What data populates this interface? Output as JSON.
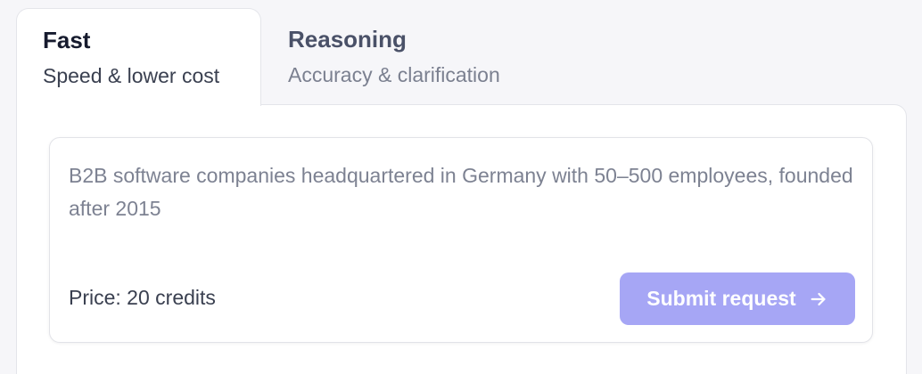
{
  "tabs": [
    {
      "title": "Fast",
      "subtitle": "Speed & lower cost",
      "active": true
    },
    {
      "title": "Reasoning",
      "subtitle": "Accuracy & clarification",
      "active": false
    }
  ],
  "query": {
    "text": "B2B software companies headquartered in Germany with 50–500 employees, founded after 2015"
  },
  "footer": {
    "price_label": "Price: 20 credits",
    "submit_label": "Submit request",
    "submit_icon": "arrow-right-icon"
  },
  "colors": {
    "background": "#f6f6f9",
    "submit_button": "#a6a6f5",
    "title_text": "#161b2e",
    "placeholder_text": "#7d8292"
  }
}
